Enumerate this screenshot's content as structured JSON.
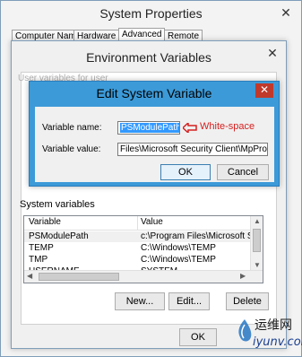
{
  "system_properties": {
    "title": "System Properties",
    "tabs": [
      "Computer Name",
      "Hardware",
      "Advanced",
      "Remote"
    ],
    "active_tab": "Advanced",
    "ok_label": "OK"
  },
  "environment_variables": {
    "title": "Environment Variables",
    "user_vars_label": "User variables for user",
    "system_vars_label": "System variables",
    "columns": [
      "Variable",
      "Value"
    ],
    "rows": [
      {
        "name": "PSModulePath",
        "value": "c:\\Program Files\\Microsoft Securi"
      },
      {
        "name": "TEMP",
        "value": "C:\\Windows\\TEMP"
      },
      {
        "name": "TMP",
        "value": "C:\\Windows\\TEMP"
      },
      {
        "name": "USERNAME",
        "value": "SYSTEM"
      }
    ],
    "buttons": {
      "new": "New...",
      "edit": "Edit...",
      "delete": "Delete"
    }
  },
  "edit_dialog": {
    "title": "Edit System Variable",
    "variable_name_label": "Variable name:",
    "variable_value_label": "Variable value:",
    "variable_name_value": "PSModulePath",
    "variable_value_value": "Files\\Microsoft Security Client\\MpProvider\\",
    "annotation": "White-space",
    "ok_label": "OK",
    "cancel_label": "Cancel",
    "close_symbol": "✕"
  },
  "watermark": {
    "cn": "运维网",
    "en": "iyunv.com"
  },
  "colors": {
    "dialog_border": "#3c9ad8",
    "annotation": "#d62020",
    "selection": "#3399ff"
  }
}
